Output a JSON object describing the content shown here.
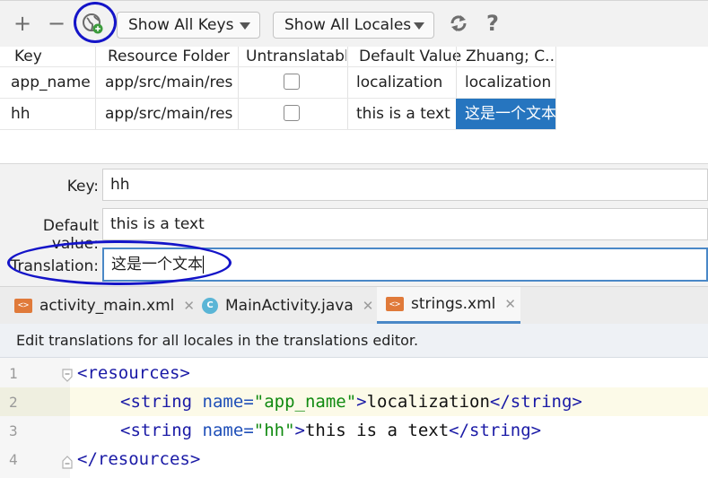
{
  "toolbar": {
    "add_label": "+",
    "remove_label": "−",
    "keys_filter": "Show All Keys",
    "locales_filter": "Show All Locales",
    "help_label": "?"
  },
  "table": {
    "headers": [
      "Key",
      "Resource Folder",
      "Untranslatable",
      "Default Value",
      "Zhuang; C..."
    ],
    "rows": [
      {
        "key": "app_name",
        "folder": "app/src/main/res",
        "default": "localization",
        "translation": "localization"
      },
      {
        "key": "hh",
        "folder": "app/src/main/res",
        "default": "this is a text",
        "translation": "这是一个文本"
      }
    ]
  },
  "form": {
    "key_label": "Key:",
    "key_value": "hh",
    "default_label": "Default value:",
    "default_value": "this is a text",
    "translation_label": "Translation:",
    "translation_value": "这是一个文本"
  },
  "tabs": [
    {
      "label": "activity_main.xml",
      "icon": "xml-file-icon"
    },
    {
      "label": "MainActivity.java",
      "icon": "java-class-icon"
    },
    {
      "label": "strings.xml",
      "icon": "xml-file-icon"
    }
  ],
  "banner": "Edit translations for all locales in the translations editor.",
  "editor": {
    "line_numbers": [
      "1",
      "2",
      "3",
      "4"
    ],
    "resources_tag": "resources",
    "string_tag": "string",
    "name_attr": "name",
    "line2_name": "\"app_name\"",
    "line2_text": "localization",
    "line3_name": "\"hh\"",
    "line3_text": "this is a text"
  },
  "colors": {
    "selection": "#2675bf",
    "annotation": "#1414c8",
    "active_tab_underline": "#4a88c7"
  }
}
